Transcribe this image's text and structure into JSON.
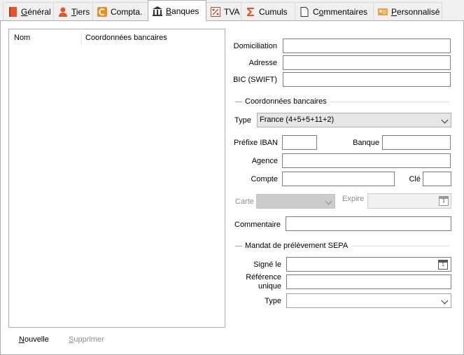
{
  "tabs": [
    {
      "label": "Général",
      "underline": "G",
      "rest": "énéral",
      "icon": "general-book-icon"
    },
    {
      "label": "Tiers",
      "underline": "T",
      "rest": "iers",
      "icon": "person-icon"
    },
    {
      "label": "Compta.",
      "underline": "",
      "rest": "Compta.",
      "icon": "compta-icon"
    },
    {
      "label": "Banques",
      "underline": "B",
      "rest": "anques",
      "icon": "bank-icon",
      "active": true
    },
    {
      "label": "TVA",
      "underline": "",
      "rest": "TVA",
      "icon": "percent-icon"
    },
    {
      "label": "Cumuls",
      "underline": "",
      "rest": "Cumuls",
      "icon": "sigma-icon"
    },
    {
      "label": "Commentaires",
      "underline": "o",
      "pre": "C",
      "rest": "mmentaires",
      "icon": "document-icon"
    },
    {
      "label": "Personnalisé",
      "underline": "P",
      "rest": "ersonnalisé",
      "icon": "vcard-icon"
    }
  ],
  "list": {
    "columns": [
      "Nom",
      "Coordonnées bancaires"
    ]
  },
  "buttons": {
    "nouvelle": "Nouvelle",
    "nouvelle_u": "N",
    "nouvelle_rest": "ouvelle",
    "supprimer": "Supprimer",
    "supprimer_u": "S",
    "supprimer_rest": "upprimer"
  },
  "form": {
    "domiciliation_label": "Domiciliation",
    "adresse_label": "Adresse",
    "bic_label": "BIC (SWIFT)",
    "coordonnees_section": "Coordonnées bancaires",
    "type_label": "Type",
    "type_value": "France (4+5+5+11+2)",
    "prefixe_label": "Préfixe IBAN",
    "banque_label": "Banque",
    "agence_label": "Agence",
    "compte_label": "Compte",
    "cle_label": "Clé",
    "carte_label": "Carte",
    "expire_label": "Expire",
    "commentaire_label": "Commentaire",
    "mandat_section": "Mandat de prélèvement SEPA",
    "signe_label": "Signé le",
    "reference_label_1": "Référence",
    "reference_label_2": "unique",
    "type2_label": "Type"
  },
  "calendar_icon_text": "1",
  "colors": {
    "accent_orange": "#e8542a",
    "tab_border_active": "#adadad",
    "disabled_fill": "#cccccc"
  }
}
